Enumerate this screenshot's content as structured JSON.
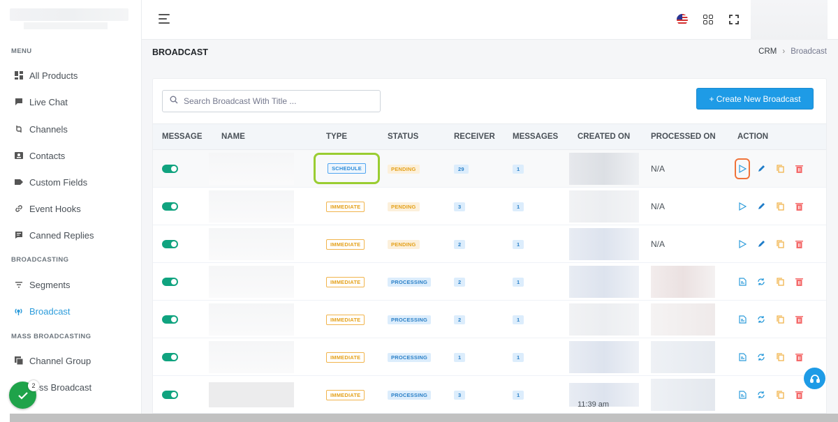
{
  "sidebar": {
    "sections": [
      {
        "title": "MENU",
        "items": [
          {
            "label": "All Products",
            "icon": "grid-icon"
          },
          {
            "label": "Live Chat",
            "icon": "chat-icon"
          },
          {
            "label": "Channels",
            "icon": "channels-icon"
          },
          {
            "label": "Contacts",
            "icon": "contact-card-icon"
          },
          {
            "label": "Custom Fields",
            "icon": "tag-icon"
          },
          {
            "label": "Event Hooks",
            "icon": "link-icon"
          },
          {
            "label": "Canned Replies",
            "icon": "message-icon"
          }
        ]
      },
      {
        "title": "BROADCASTING",
        "items": [
          {
            "label": "Segments",
            "icon": "filter-icon"
          },
          {
            "label": "Broadcast",
            "icon": "broadcast-icon",
            "active": true
          }
        ]
      },
      {
        "title": "MASS BROADCASTING",
        "items": [
          {
            "label": "Channel Group",
            "icon": "stack-icon"
          },
          {
            "label": "ss Broadcast",
            "icon": "mass-broadcast-icon"
          }
        ]
      }
    ]
  },
  "header": {
    "page_title": "BROADCAST",
    "breadcrumb": {
      "root": "CRM",
      "current": "Broadcast"
    }
  },
  "toolbar": {
    "search_placeholder": "Search Broadcast With Title ...",
    "create_button": "+ Create New Broadcast"
  },
  "table": {
    "columns": [
      "MESSAGE",
      "NAME",
      "TYPE",
      "STATUS",
      "RECEIVER",
      "MESSAGES",
      "CREATED ON",
      "PROCESSED ON",
      "ACTION"
    ],
    "rows": [
      {
        "enabled": true,
        "type": "SCHEDULE",
        "status": "PENDING",
        "receiver": "29",
        "messages": "1",
        "processed_on": "N/A",
        "actions": "pending"
      },
      {
        "enabled": true,
        "type": "IMMEDIATE",
        "status": "PENDING",
        "receiver": "3",
        "messages": "1",
        "processed_on": "N/A",
        "actions": "pending"
      },
      {
        "enabled": true,
        "type": "IMMEDIATE",
        "status": "PENDING",
        "receiver": "2",
        "messages": "1",
        "processed_on": "N/A",
        "actions": "pending"
      },
      {
        "enabled": true,
        "type": "IMMEDIATE",
        "status": "PROCESSING",
        "receiver": "2",
        "messages": "1",
        "processed_on": "",
        "actions": "processing"
      },
      {
        "enabled": true,
        "type": "IMMEDIATE",
        "status": "PROCESSING",
        "receiver": "2",
        "messages": "1",
        "processed_on": "",
        "actions": "processing"
      },
      {
        "enabled": true,
        "type": "IMMEDIATE",
        "status": "PROCESSING",
        "receiver": "1",
        "messages": "1",
        "processed_on": "",
        "actions": "processing"
      },
      {
        "enabled": true,
        "type": "IMMEDIATE",
        "status": "PROCESSING",
        "receiver": "3",
        "messages": "1",
        "processed_on": "",
        "actions": "processing",
        "created_partial": "11:39 am"
      }
    ]
  },
  "notifications": {
    "count": "2"
  },
  "colors": {
    "accent": "#1e9be6",
    "toggle": "#10a37f",
    "delete": "#f46a6a",
    "copy": "#f1b44c",
    "highlight": "#9acd32",
    "action_box": "#f0733a"
  }
}
